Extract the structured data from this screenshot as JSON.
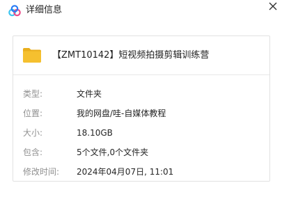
{
  "window": {
    "title": "详细信息",
    "app_icon": "baidu-netdisk-cloud-icon",
    "close_icon": "close-icon"
  },
  "file": {
    "icon": "folder-icon",
    "name": "【ZMT10142】短视频拍摄剪辑训练营"
  },
  "details": [
    {
      "label": "类型:",
      "value": "文件夹"
    },
    {
      "label": "位置:",
      "value": "我的网盘/哇-自媒体教程"
    },
    {
      "label": "大小:",
      "value": "18.10GB"
    },
    {
      "label": "包含:",
      "value": "5个文件,0个文件夹"
    },
    {
      "label": "修改时间:",
      "value": "2024年04月07日, 11:01"
    }
  ],
  "colors": {
    "folder": "#F5C02F",
    "logo_blue": "#2A7CF5",
    "logo_cyan": "#3DC5F0",
    "logo_pink": "#EB4C8A"
  }
}
